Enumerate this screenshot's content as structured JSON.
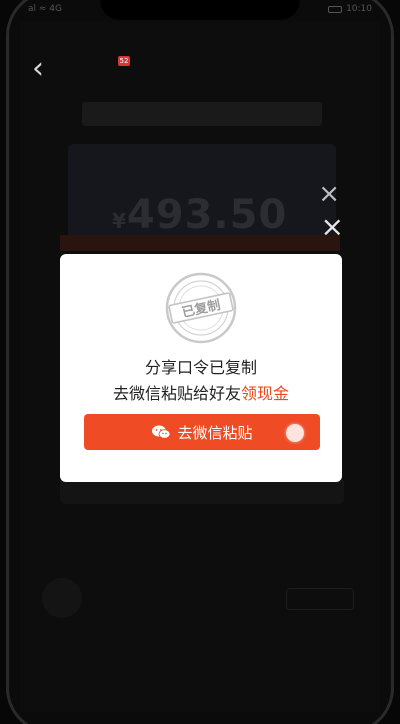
{
  "status": {
    "left": "al ≈ 4G",
    "right": "10:10"
  },
  "nav": {
    "badge": "52"
  },
  "underlay": {
    "currency": "¥",
    "amount": "493.50"
  },
  "modal": {
    "stamp_text": "已复制",
    "line1": "分享口令已复制",
    "line2_prefix": "去微信粘贴给好友",
    "line2_link": "领现金",
    "button_label": "去微信粘贴"
  },
  "colors": {
    "accent": "#ef4b25",
    "link": "#f0461e"
  }
}
